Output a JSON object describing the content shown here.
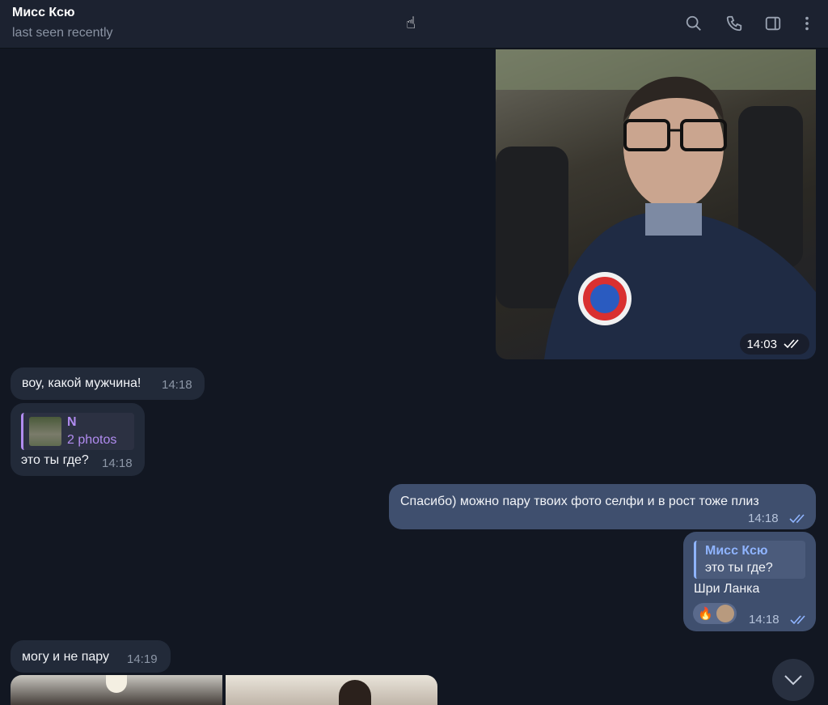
{
  "header": {
    "title": "Мисс Ксю",
    "status": "last seen recently"
  },
  "photo_message": {
    "time": "14:03"
  },
  "messages": [
    {
      "text": "воу, какой мужчина!",
      "time": "14:18"
    },
    {
      "reply_name": "N",
      "reply_text": "2 photos",
      "text": "это ты где?",
      "time": "14:18"
    },
    {
      "text": "Спасибо) можно пару твоих фото селфи и в рост тоже плиз",
      "time": "14:18"
    },
    {
      "reply_name": "Мисс Ксю",
      "reply_text": "это ты где?",
      "text": "Шри Ланка",
      "time": "14:18",
      "reaction": "🔥"
    },
    {
      "text": "могу и не пару",
      "time": "14:19"
    }
  ],
  "colors": {
    "background": "#121722",
    "incoming": "#222a39",
    "outgoing": "#3f4f6e",
    "reply_accent_in": "#b18cf0",
    "reply_accent_out": "#8fb4ff"
  }
}
